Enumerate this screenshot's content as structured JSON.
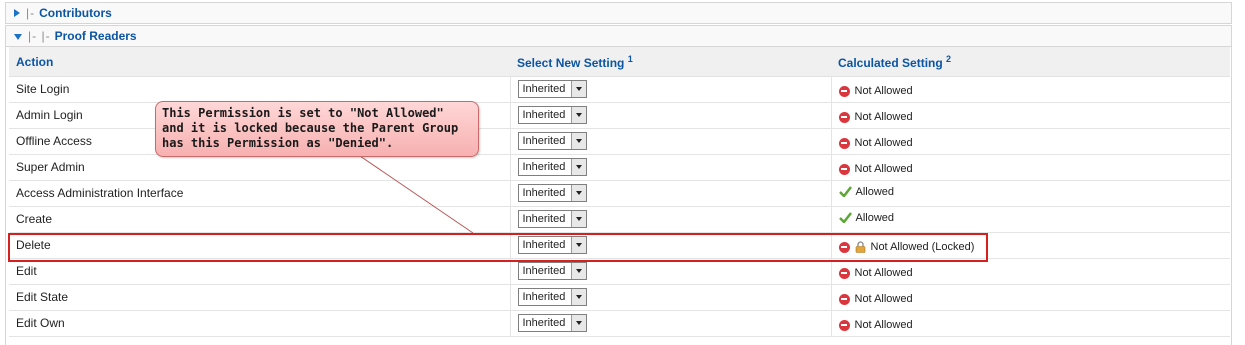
{
  "groups": {
    "contributors": "Contributors",
    "proof_readers": "Proof Readers",
    "tree_marker": "|-",
    "tree_marker_nested": "|- |-"
  },
  "table": {
    "headers": {
      "action": "Action",
      "select_new": "Select New Setting",
      "select_new_sup": "1",
      "calculated": "Calculated Setting",
      "calculated_sup": "2"
    },
    "rows": [
      {
        "action": "Site Login",
        "select": "Inherited",
        "status": "Not Allowed",
        "type": "denied"
      },
      {
        "action": "Admin Login",
        "select": "Inherited",
        "status": "Not Allowed",
        "type": "denied"
      },
      {
        "action": "Offline Access",
        "select": "Inherited",
        "status": "Not Allowed",
        "type": "denied"
      },
      {
        "action": "Super Admin",
        "select": "Inherited",
        "status": "Not Allowed",
        "type": "denied"
      },
      {
        "action": "Access Administration Interface",
        "select": "Inherited",
        "status": "Allowed",
        "type": "allowed"
      },
      {
        "action": "Create",
        "select": "Inherited",
        "status": "Allowed",
        "type": "allowed"
      },
      {
        "action": "Delete",
        "select": "Inherited",
        "status": "Not Allowed (Locked)",
        "type": "locked"
      },
      {
        "action": "Edit",
        "select": "Inherited",
        "status": "Not Allowed",
        "type": "denied"
      },
      {
        "action": "Edit State",
        "select": "Inherited",
        "status": "Not Allowed",
        "type": "denied"
      },
      {
        "action": "Edit Own",
        "select": "Inherited",
        "status": "Not Allowed",
        "type": "denied"
      }
    ]
  },
  "callout": {
    "text": "This Permission is set to \"Not Allowed\"\nand it is locked because the Parent Group\nhas this Permission as \"Denied\"."
  },
  "colors": {
    "accent": "#0b55a4",
    "denied": "#d9363e",
    "allowed": "#5aa832",
    "highlight": "#d61f1f"
  },
  "icons": {
    "denied": "minus-circle-icon",
    "allowed": "checkmark-icon",
    "locked": "padlock-icon",
    "collapsed": "triangle-right-icon",
    "expanded": "triangle-down-icon",
    "dropdown": "chevron-down-icon"
  }
}
